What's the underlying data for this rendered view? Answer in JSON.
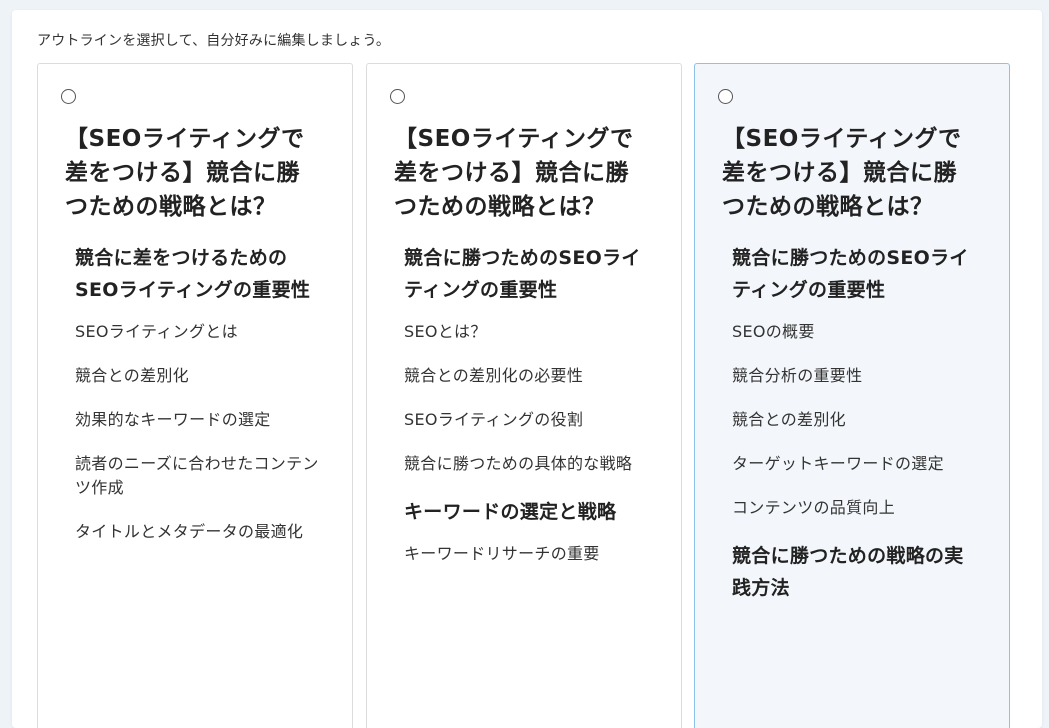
{
  "instruction": "アウトラインを選択して、自分好みに編集しましょう。",
  "cards": [
    {
      "title": "【SEOライティングで差をつける】競合に勝つための戦略とは？",
      "selected": false,
      "items": [
        {
          "level": "h2",
          "text": "競合に差をつけるためのSEOライティングの重要性"
        },
        {
          "level": "h3",
          "text": "SEOライティングとは"
        },
        {
          "level": "h3",
          "text": "競合との差別化"
        },
        {
          "level": "h3",
          "text": "効果的なキーワードの選定"
        },
        {
          "level": "h3",
          "text": "読者のニーズに合わせたコンテンツ作成"
        },
        {
          "level": "h3",
          "text": "タイトルとメタデータの最適化"
        }
      ]
    },
    {
      "title": "【SEOライティングで差をつける】競合に勝つための戦略とは？",
      "selected": false,
      "items": [
        {
          "level": "h2",
          "text": "競合に勝つためのSEOライティングの重要性"
        },
        {
          "level": "h3",
          "text": "SEOとは？"
        },
        {
          "level": "h3",
          "text": "競合との差別化の必要性"
        },
        {
          "level": "h3",
          "text": "SEOライティングの役割"
        },
        {
          "level": "h3",
          "text": "競合に勝つための具体的な戦略"
        },
        {
          "level": "h2",
          "text": "キーワードの選定と戦略"
        },
        {
          "level": "h3",
          "text": "キーワードリサーチの重要"
        }
      ]
    },
    {
      "title": "【SEOライティングで差をつける】競合に勝つための戦略とは？",
      "selected": true,
      "items": [
        {
          "level": "h2",
          "text": "競合に勝つためのSEOライティングの重要性"
        },
        {
          "level": "h3",
          "text": "SEOの概要"
        },
        {
          "level": "h3",
          "text": "競合分析の重要性"
        },
        {
          "level": "h3",
          "text": "競合との差別化"
        },
        {
          "level": "h3",
          "text": "ターゲットキーワードの選定"
        },
        {
          "level": "h3",
          "text": "コンテンツの品質向上"
        },
        {
          "level": "h2",
          "text": "競合に勝つための戦略の実践方法"
        }
      ]
    }
  ],
  "colors": {
    "selected_background": "#f3f7fb",
    "selected_border": "#8ec1ea",
    "card_border": "#dcdcdc"
  }
}
